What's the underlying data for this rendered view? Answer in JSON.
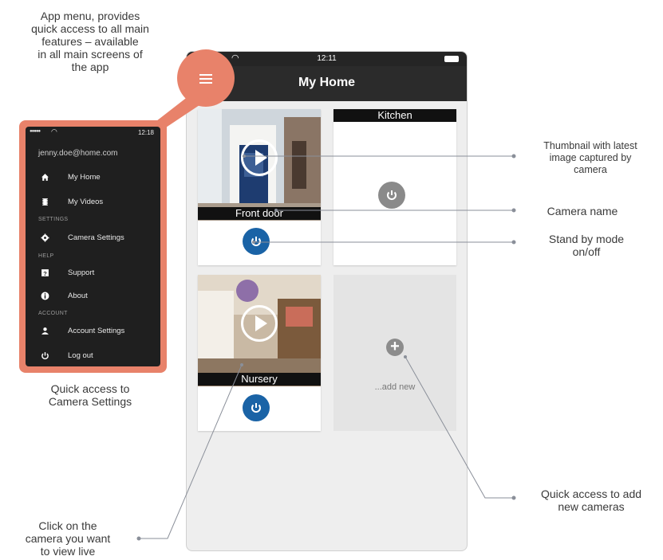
{
  "callouts": {
    "app_menu": [
      "App menu, provides",
      "quick access to all main",
      "features – available",
      "in all main screens of",
      "the app"
    ],
    "quick_camera_settings": [
      "Quick access to",
      "Camera Settings"
    ],
    "thumbnail": [
      "Thumbnail with latest",
      "image captured by",
      "camera"
    ],
    "camera_name": "Camera name",
    "standby": [
      "Stand by mode",
      "on/off"
    ],
    "add_cameras": [
      "Quick access to add",
      "new cameras"
    ],
    "view_live": [
      "Click on the",
      "camera you want",
      "to view live"
    ]
  },
  "phone": {
    "status": {
      "signal": "●●●●●",
      "time": "12:11"
    },
    "header": {
      "title": "My Home"
    },
    "cameras": [
      {
        "name": "Front door",
        "state": "on"
      },
      {
        "name": "Kitchen",
        "state": "standby"
      },
      {
        "name": "Nursery",
        "state": "on"
      }
    ],
    "add_new_label": "...add new"
  },
  "side_menu": {
    "status": {
      "signal": "●●●●●",
      "time": "12:18"
    },
    "user_email": "jenny.doe@home.com",
    "items": [
      {
        "label": "My Home",
        "icon": "home-icon"
      },
      {
        "label": "My Videos",
        "icon": "film-icon"
      },
      {
        "label": "Camera Settings",
        "icon": "gear-icon"
      },
      {
        "label": "Support",
        "icon": "help-icon"
      },
      {
        "label": "About",
        "icon": "info-icon"
      },
      {
        "label": "Account Settings",
        "icon": "user-icon"
      },
      {
        "label": "Log out",
        "icon": "power-icon"
      }
    ],
    "sections": {
      "settings": "SETTINGS",
      "help": "HELP",
      "account": "ACCOUNT"
    }
  },
  "colors": {
    "accent": "#e8826a",
    "power_on": "#1a63a6",
    "power_off": "#8a8a8a",
    "header_bg": "#2b2b2b"
  }
}
